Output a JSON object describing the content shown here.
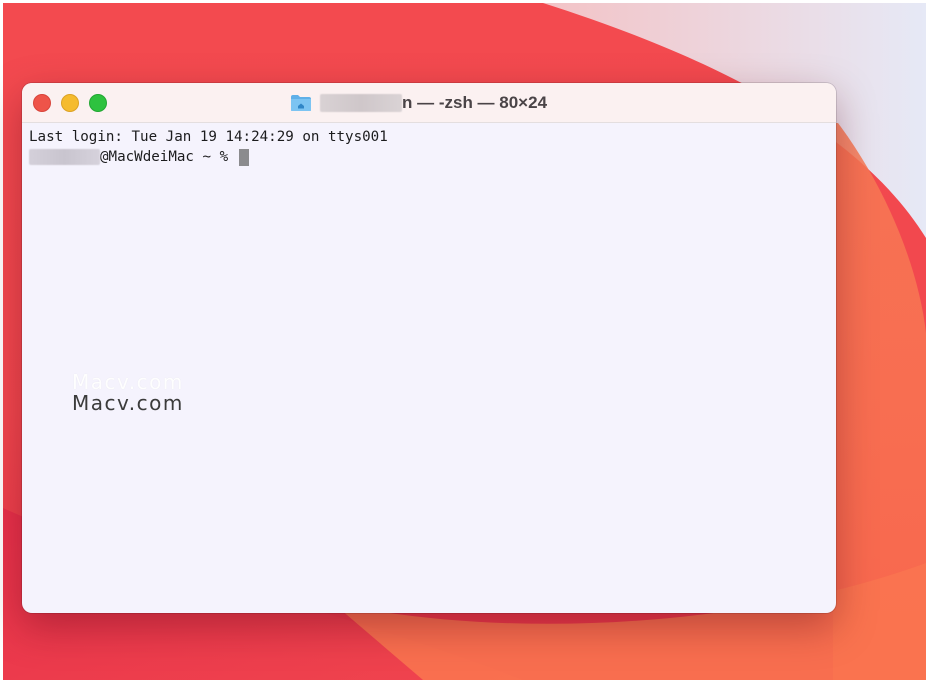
{
  "window": {
    "title_suffix": "n — -zsh — 80×24",
    "icon": "home-folder-icon"
  },
  "terminal": {
    "last_login": "Last login: Tue Jan 19 14:24:29 on ttys001",
    "prompt": "@MacWdeiMac ~ % "
  },
  "watermark": {
    "text_top": "Macv.com",
    "text_bottom": "Macv.com"
  },
  "colors": {
    "close": "#ee5449",
    "minimize": "#f5bb2e",
    "maximize": "#2ec23f",
    "terminal_bg": "#f5f3fd",
    "titlebar_bg": "#fbf1f1"
  }
}
